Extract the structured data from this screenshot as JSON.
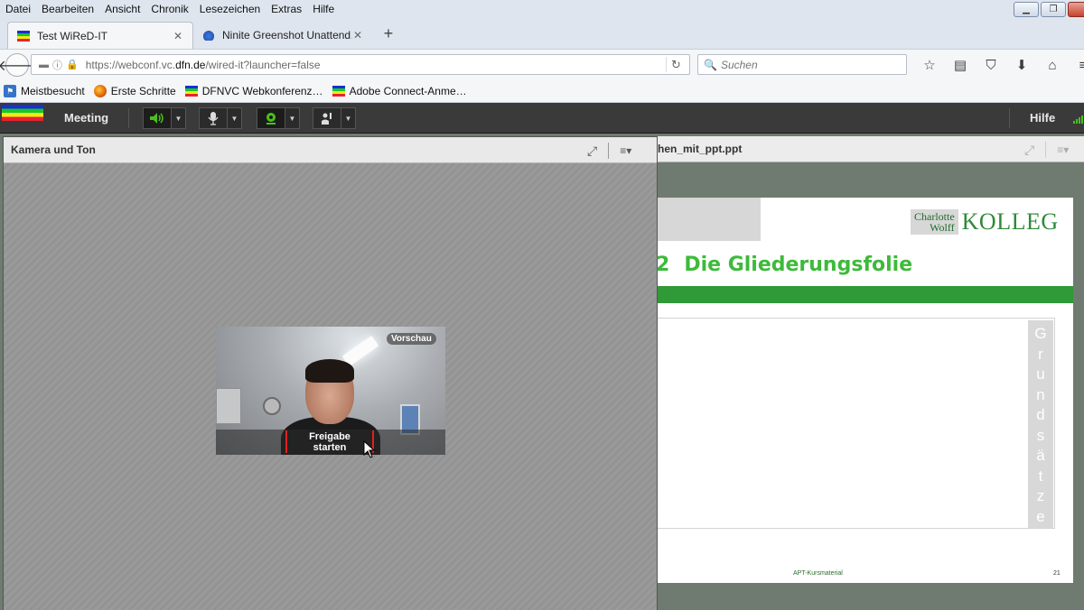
{
  "menubar": {
    "items": [
      "Datei",
      "Bearbeiten",
      "Ansicht",
      "Chronik",
      "Lesezeichen",
      "Extras",
      "Hilfe"
    ]
  },
  "tabs": [
    {
      "label": "Test WiReD-IT",
      "icon": "adobe-connect-icon",
      "active": true
    },
    {
      "label": "Ninite Greenshot Unattend…",
      "icon": "ninite-icon",
      "active": false
    }
  ],
  "navbar": {
    "url_prefix": "https://webconf.vc.",
    "url_domain": "dfn.de",
    "url_path": "/wired-it?launcher=false",
    "search_placeholder": "Suchen"
  },
  "bookmarks": [
    {
      "label": "Meistbesucht",
      "icon": "bookmarks-icon"
    },
    {
      "label": "Erste Schritte",
      "icon": "firefox-icon"
    },
    {
      "label": "DFNVC Webkonferenz…",
      "icon": "adobe-connect-icon"
    },
    {
      "label": "Adobe Connect-Anme…",
      "icon": "adobe-connect-icon"
    }
  ],
  "connect": {
    "menu_meeting": "Meeting",
    "menu_help": "Hilfe",
    "accent_green": "#49c21a"
  },
  "left_pod": {
    "title": "Kamera und Ton",
    "preview_badge": "Vorschau",
    "start_button": "Freigabe starten",
    "highlight_color": "#e02020"
  },
  "right_pod": {
    "title": "hen_mit_ppt.ppt",
    "slide": {
      "logo_line1": "Charlotte",
      "logo_line2": "Wolff",
      "logo_word": "KOLLEG",
      "heading_number": "2",
      "heading_text": "Die Gliederungsfolie",
      "vertical_letters": [
        "G",
        "r",
        "u",
        "n",
        "d",
        "s",
        "ä",
        "t",
        "z",
        "e"
      ],
      "footer": "APT-Kursmaterial",
      "page_number": "21",
      "heading_color": "#3dba3a",
      "bar_color": "#2f9a37"
    }
  }
}
